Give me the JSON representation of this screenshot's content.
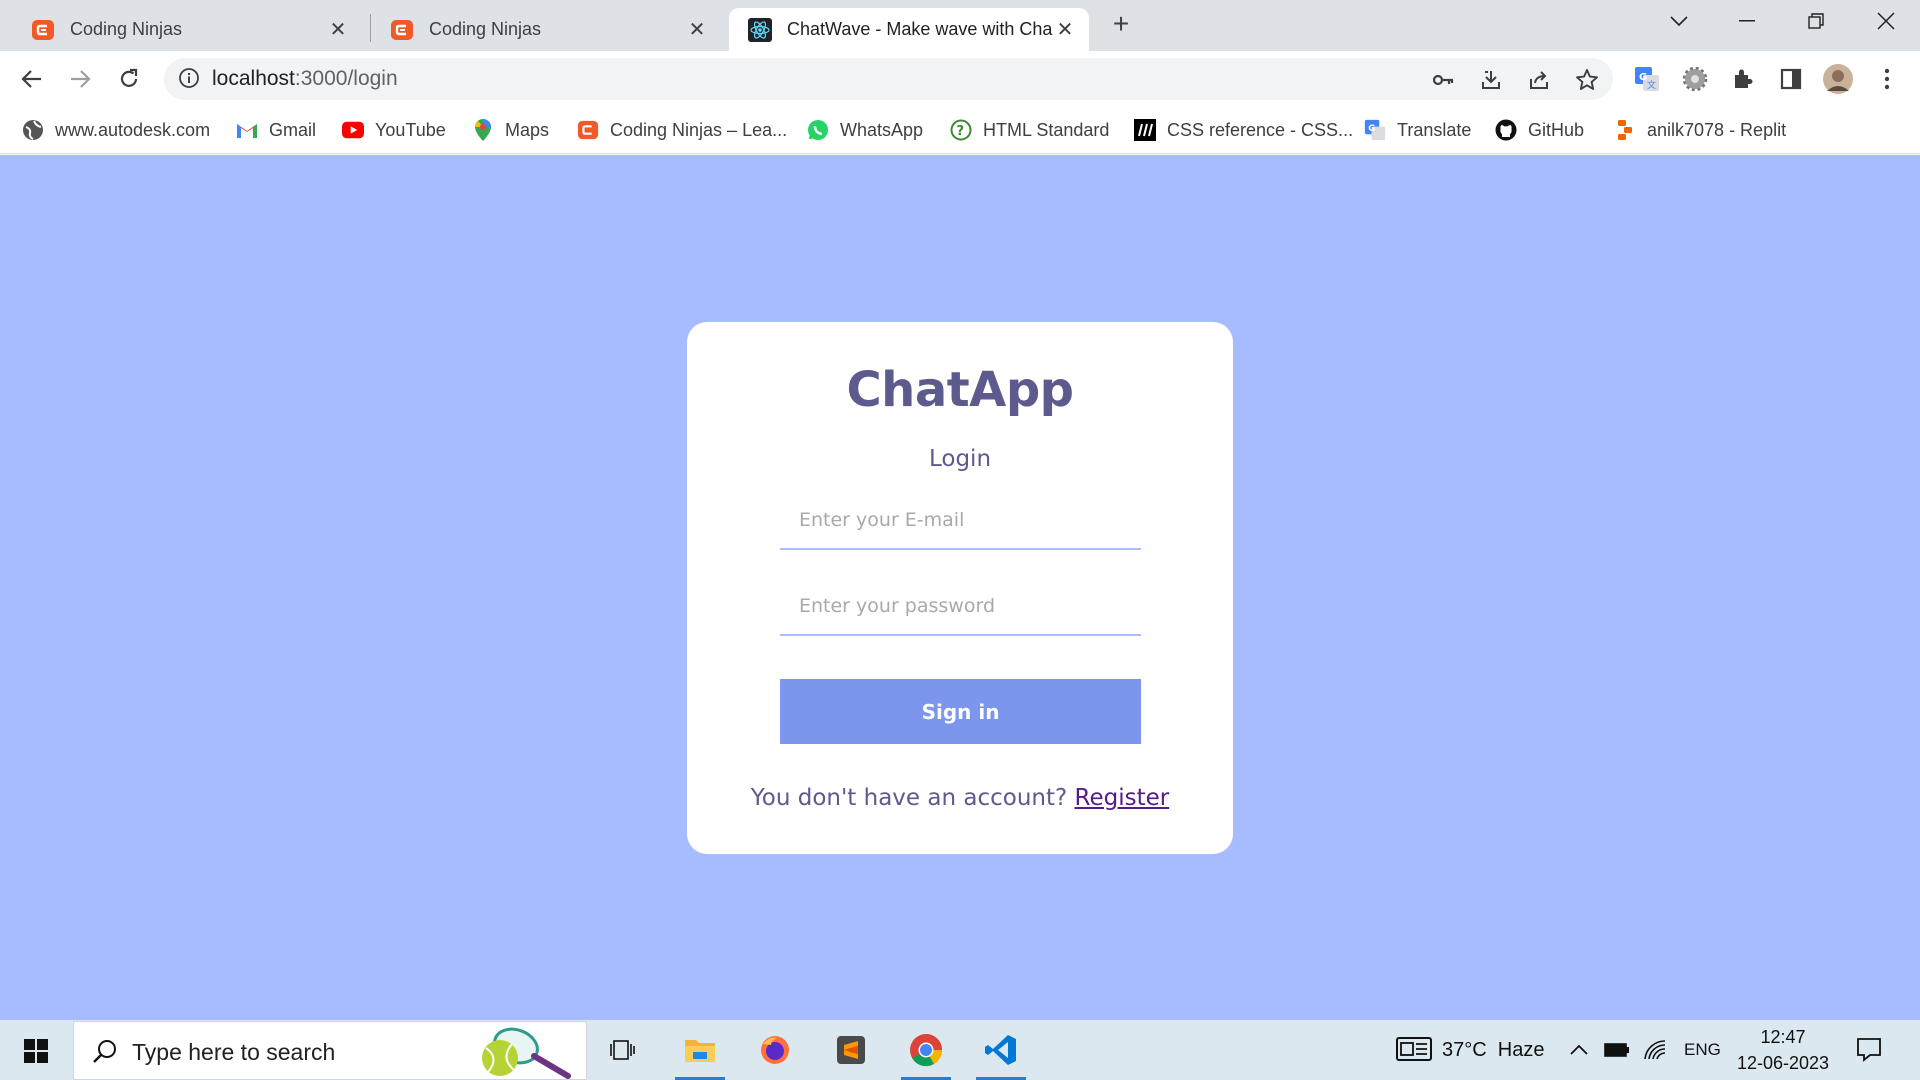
{
  "browser": {
    "tabs": [
      {
        "title": "Coding Ninjas",
        "icon": "coding-ninjas-icon",
        "active": false
      },
      {
        "title": "Coding Ninjas",
        "icon": "coding-ninjas-icon",
        "active": false
      },
      {
        "title": "ChatWave - Make wave with Cha",
        "icon": "react-icon",
        "active": true
      }
    ],
    "url_host": "localhost",
    "url_path": ":3000/login",
    "bookmarks": [
      {
        "label": "www.autodesk.com",
        "icon": "autodesk-icon"
      },
      {
        "label": "Gmail",
        "icon": "gmail-icon"
      },
      {
        "label": "YouTube",
        "icon": "youtube-icon"
      },
      {
        "label": "Maps",
        "icon": "maps-icon"
      },
      {
        "label": "Coding Ninjas – Lea...",
        "icon": "coding-ninjas-icon"
      },
      {
        "label": "WhatsApp",
        "icon": "whatsapp-icon"
      },
      {
        "label": "HTML Standard",
        "icon": "html-standard-icon"
      },
      {
        "label": "CSS reference - CSS...",
        "icon": "mdn-icon"
      },
      {
        "label": "Translate",
        "icon": "translate-icon"
      },
      {
        "label": "GitHub",
        "icon": "github-icon"
      },
      {
        "label": "anilk7078 - Replit",
        "icon": "replit-icon"
      }
    ]
  },
  "login": {
    "logo": "ChatApp",
    "title": "Login",
    "email_placeholder": "Enter your E-mail",
    "password_placeholder": "Enter your password",
    "signin_label": "Sign in",
    "footer_text": "You don't have an account? ",
    "register_link": "Register"
  },
  "taskbar": {
    "search_placeholder": "Type here to search",
    "weather": "37°C  Haze",
    "language": "ENG",
    "time": "12:47",
    "date": "12-06-2023"
  },
  "colors": {
    "page_background": "#a7bcff",
    "brand_text": "#5d5b8d",
    "button": "#7b96ec"
  }
}
